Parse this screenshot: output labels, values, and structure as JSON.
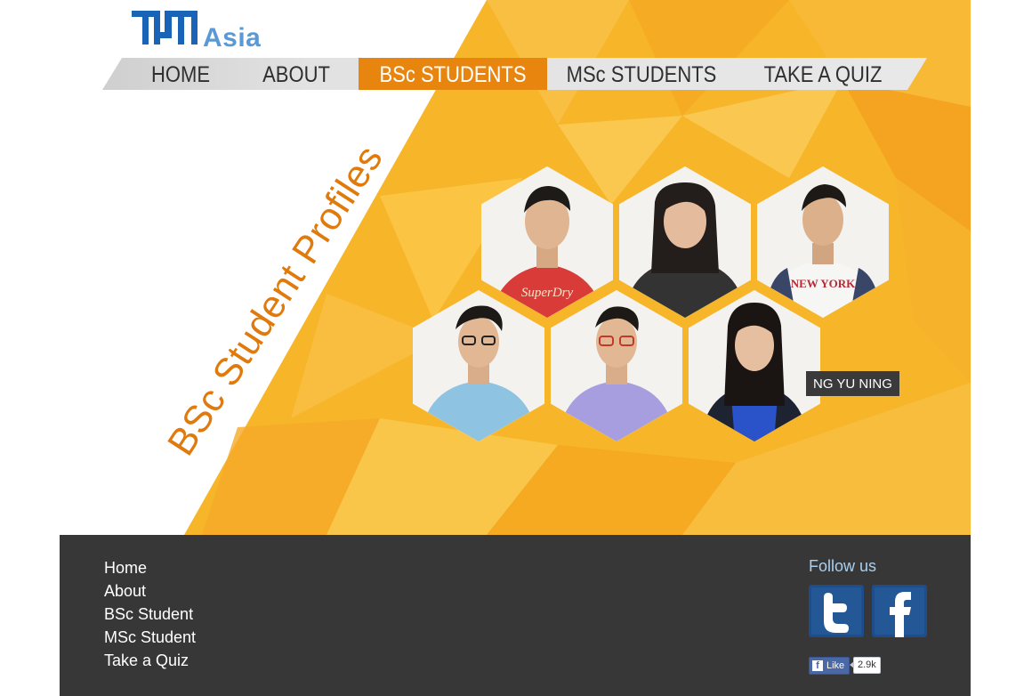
{
  "brand": {
    "logo_mark": "TUM",
    "logo_text": "Asia"
  },
  "nav": {
    "items": [
      {
        "label": "HOME"
      },
      {
        "label": "ABOUT"
      },
      {
        "label": "BSc STUDENTS"
      },
      {
        "label": "MSc STUDENTS"
      },
      {
        "label": "TAKE A QUIZ"
      }
    ],
    "active": "BSc STUDENTS"
  },
  "hero": {
    "title": "BSc Student Profiles",
    "highlighted_name": "NG YU NING",
    "profiles_count": 6
  },
  "footer": {
    "links": [
      "Home",
      "About",
      "BSc Student",
      "MSc Student",
      "Take a Quiz"
    ],
    "follow_title": "Follow us",
    "social": [
      {
        "name": "twitter-icon",
        "glyph": "t"
      },
      {
        "name": "facebook-icon",
        "glyph": "f"
      }
    ],
    "like_label": "Like",
    "like_count": "2.9k"
  },
  "colors": {
    "accent_orange": "#e8850f",
    "hero_yellow": "#f7b52a",
    "footer_bg": "#373737",
    "follow_blue": "#a9cff0",
    "brand_blue": "#1a64b8",
    "social_blue": "#1d4d8a"
  }
}
